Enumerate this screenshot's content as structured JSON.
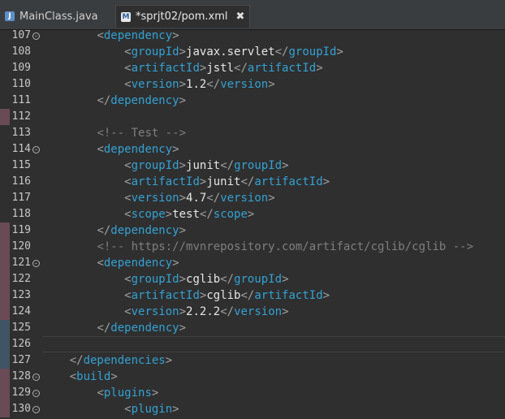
{
  "tabs": [
    {
      "label": "MainClass.java",
      "icon": "java-file-icon",
      "active": false
    },
    {
      "label": "*sprjt02/pom.xml",
      "icon": "xml-file-icon",
      "active": true,
      "close": "✖"
    }
  ],
  "lines": [
    {
      "n": "107",
      "fold": true,
      "stripe": "none",
      "indent": "        ",
      "kind": "open",
      "tag": "dependency"
    },
    {
      "n": "108",
      "fold": false,
      "stripe": "none",
      "indent": "            ",
      "kind": "elem",
      "tag": "groupId",
      "text": "javax.servlet"
    },
    {
      "n": "109",
      "fold": false,
      "stripe": "none",
      "indent": "            ",
      "kind": "elem",
      "tag": "artifactId",
      "text": "jstl"
    },
    {
      "n": "110",
      "fold": false,
      "stripe": "none",
      "indent": "            ",
      "kind": "elem",
      "tag": "version",
      "text": "1.2"
    },
    {
      "n": "111",
      "fold": false,
      "stripe": "none",
      "indent": "        ",
      "kind": "close",
      "tag": "dependency"
    },
    {
      "n": "112",
      "fold": false,
      "stripe": "pink",
      "indent": "",
      "kind": "blank"
    },
    {
      "n": "113",
      "fold": false,
      "stripe": "none",
      "indent": "        ",
      "kind": "comment",
      "text": "<!-- Test -->"
    },
    {
      "n": "114",
      "fold": true,
      "stripe": "none",
      "indent": "        ",
      "kind": "open",
      "tag": "dependency"
    },
    {
      "n": "115",
      "fold": false,
      "stripe": "none",
      "indent": "            ",
      "kind": "elem",
      "tag": "groupId",
      "text": "junit"
    },
    {
      "n": "116",
      "fold": false,
      "stripe": "none",
      "indent": "            ",
      "kind": "elem",
      "tag": "artifactId",
      "text": "junit"
    },
    {
      "n": "117",
      "fold": false,
      "stripe": "none",
      "indent": "            ",
      "kind": "elem",
      "tag": "version",
      "text": "4.7"
    },
    {
      "n": "118",
      "fold": false,
      "stripe": "none",
      "indent": "            ",
      "kind": "elem",
      "tag": "scope",
      "text": "test"
    },
    {
      "n": "119",
      "fold": false,
      "stripe": "pink",
      "indent": "        ",
      "kind": "close",
      "tag": "dependency"
    },
    {
      "n": "120",
      "fold": false,
      "stripe": "pink",
      "indent": "        ",
      "kind": "comment",
      "text": "<!-- https://mvnrepository.com/artifact/cglib/cglib -->"
    },
    {
      "n": "121",
      "fold": true,
      "stripe": "pink",
      "indent": "        ",
      "kind": "open",
      "tag": "dependency"
    },
    {
      "n": "122",
      "fold": false,
      "stripe": "pink",
      "indent": "            ",
      "kind": "elem",
      "tag": "groupId",
      "text": "cglib"
    },
    {
      "n": "123",
      "fold": false,
      "stripe": "pink",
      "indent": "            ",
      "kind": "elem",
      "tag": "artifactId",
      "text": "cglib"
    },
    {
      "n": "124",
      "fold": false,
      "stripe": "pink",
      "indent": "            ",
      "kind": "elem",
      "tag": "version",
      "text": "2.2.2"
    },
    {
      "n": "125",
      "fold": false,
      "stripe": "blue",
      "indent": "        ",
      "kind": "close",
      "tag": "dependency"
    },
    {
      "n": "126",
      "fold": false,
      "stripe": "blue",
      "indent": "",
      "kind": "blank",
      "current": true
    },
    {
      "n": "127",
      "fold": false,
      "stripe": "blue",
      "indent": "    ",
      "kind": "close",
      "tag": "dependencies"
    },
    {
      "n": "128",
      "fold": true,
      "stripe": "pink",
      "indent": "    ",
      "kind": "open",
      "tag": "build"
    },
    {
      "n": "129",
      "fold": true,
      "stripe": "pink",
      "indent": "        ",
      "kind": "open",
      "tag": "plugins"
    },
    {
      "n": "130",
      "fold": true,
      "stripe": "pink",
      "indent": "            ",
      "kind": "open",
      "tag": "plugin"
    }
  ],
  "colors": {
    "tag": "#33a2d4",
    "bracket": "#a0a0a0",
    "text": "#e6e6e6",
    "comment": "#7f7f7f",
    "stripe_pink": "#6a4a55",
    "stripe_blue": "#3f5566"
  }
}
